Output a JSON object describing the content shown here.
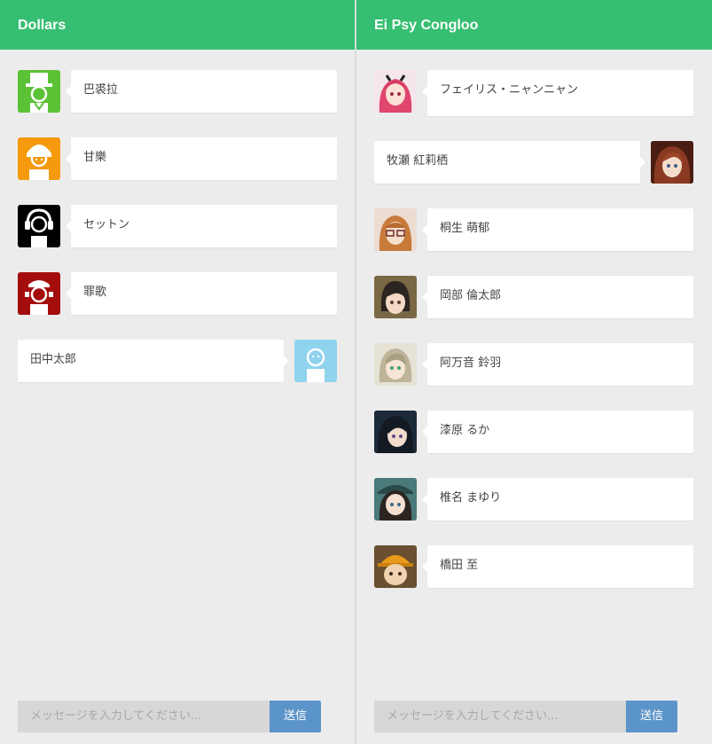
{
  "left_panel": {
    "title": "Dollars",
    "messages": [
      {
        "name": "巴裘拉",
        "avatar": "top-hat-person-icon",
        "color": "#5bc236"
      },
      {
        "name": "甘樂",
        "avatar": "girl-person-icon",
        "color": "#f59a0c"
      },
      {
        "name": "セットン",
        "avatar": "headphones-person-icon",
        "color": "#000000"
      },
      {
        "name": "罪歌",
        "avatar": "maid-person-icon",
        "color": "#a50c0c"
      },
      {
        "name": "田中太郎",
        "avatar": "plain-person-icon",
        "color": "#8fd3ec"
      }
    ],
    "input_placeholder": "メッセージを入力してください...",
    "send_label": "送信"
  },
  "right_panel": {
    "title": "Ei Psy Congloo",
    "messages": [
      {
        "name": "フェイリス・ニャンニャン",
        "avatar": "pink-hair-portrait-icon"
      },
      {
        "name": "牧瀬 紅莉栖",
        "avatar": "red-hair-portrait-icon"
      },
      {
        "name": "桐生 萌郁",
        "avatar": "glasses-portrait-icon"
      },
      {
        "name": "岡部 倫太郎",
        "avatar": "dark-hair-portrait-icon"
      },
      {
        "name": "阿万音 鈴羽",
        "avatar": "beige-hair-portrait-icon"
      },
      {
        "name": "漆原 るか",
        "avatar": "black-hair-portrait-icon"
      },
      {
        "name": "椎名 まゆり",
        "avatar": "hat-girl-portrait-icon"
      },
      {
        "name": "橋田 至",
        "avatar": "cap-portrait-icon"
      }
    ],
    "input_placeholder": "メッセージを入力してください...",
    "send_label": "送信"
  },
  "colors": {
    "header": "#36bf72",
    "send_button": "#5b94c8",
    "background": "#ececec"
  }
}
